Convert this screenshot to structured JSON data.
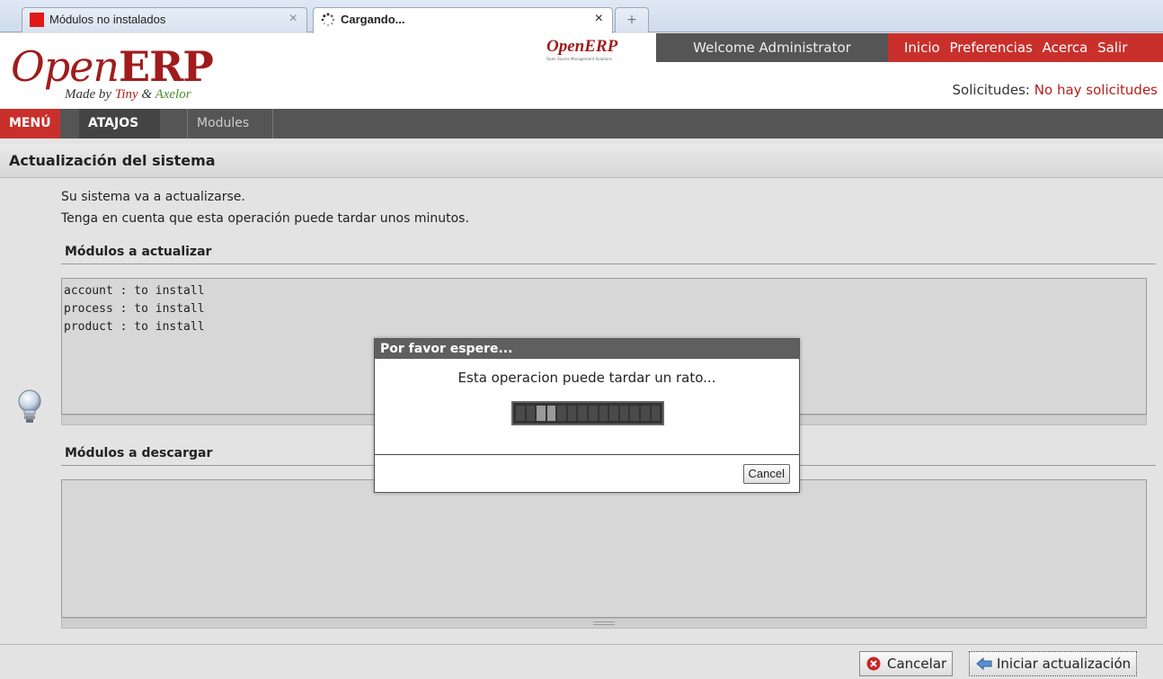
{
  "browser": {
    "tabs": [
      {
        "label": "Módulos no instalados",
        "close": "×"
      },
      {
        "label": "Cargando...",
        "close": "×"
      }
    ],
    "new_tab": "+"
  },
  "header": {
    "logo_text": "Open",
    "logo_erp": "ERP",
    "logo_sub_prefix": "Made by",
    "logo_sub_tiny": "Tiny",
    "logo_sub_amp": "&",
    "logo_sub_axelor": "Axelor",
    "small_logo": "OpenERP",
    "small_logo_sub": "Open Source Management Solutions",
    "welcome": "Welcome Administrator",
    "links": [
      "Inicio",
      "Preferencias",
      "Acerca",
      "Salir"
    ],
    "requests_label": "Solicitudes:",
    "requests_value": "No hay solicitudes"
  },
  "menubar": {
    "menu": "MENÚ",
    "atajos": "ATAJOS",
    "modules": "Modules"
  },
  "page": {
    "title": "Actualización del sistema",
    "intro1": "Su sistema va a actualizarse.",
    "intro2": "Tenga en cuenta que esta operación puede tardar unos minutos.",
    "section1_label": "Módulos a actualizar",
    "modules_to_update": [
      "account : to install",
      "process : to install",
      "product : to install"
    ],
    "section2_label": "Módulos a descargar"
  },
  "footer": {
    "cancel_label": "Cancelar",
    "start_label": "Iniciar actualización"
  },
  "modal": {
    "title": "Por favor espere...",
    "message": "Esta operacion puede tardar un rato...",
    "cancel_label": "Cancel",
    "progress_segments": 14,
    "progress_active": [
      2,
      3
    ]
  },
  "colors": {
    "brand_red": "#c9302c",
    "dark_bar": "#555555"
  }
}
